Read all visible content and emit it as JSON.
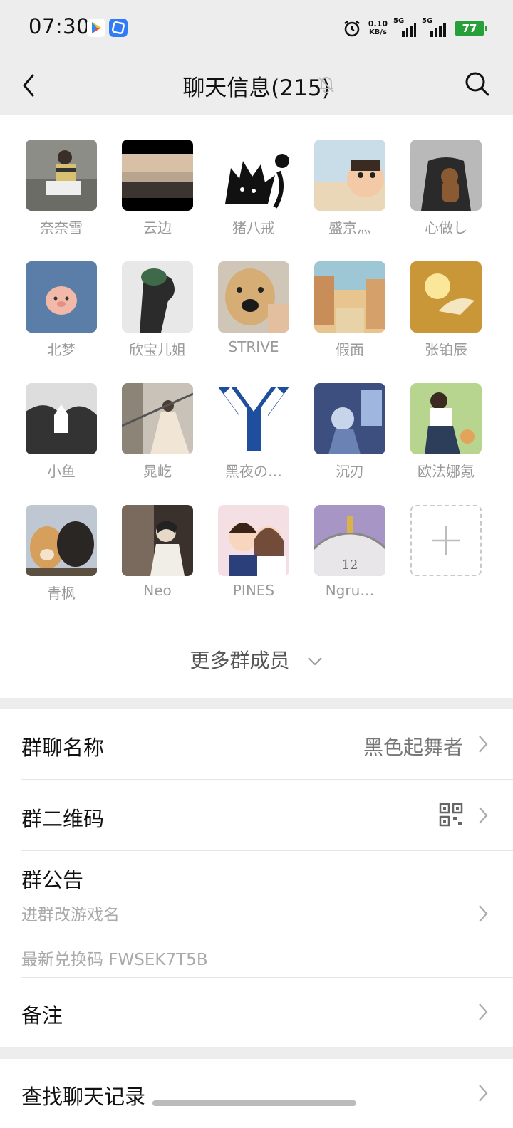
{
  "status_bar": {
    "time": "07:30",
    "net_speed_value": "0.10",
    "net_speed_unit": "KB/s",
    "signal_1_label": "5G",
    "signal_2_label": "5G",
    "battery": "77",
    "icons": [
      "play-store-icon",
      "app-icon",
      "alarm-icon"
    ]
  },
  "header": {
    "title": "聊天信息(215)",
    "back_icon": "chevron-left-icon",
    "mute_icon": "bell-off-icon",
    "search_icon": "search-icon"
  },
  "members": [
    {
      "name": "奈奈雪"
    },
    {
      "name": "云边"
    },
    {
      "name": "猪八戒"
    },
    {
      "name": "盛京灬"
    },
    {
      "name": "心做し"
    },
    {
      "name": "北梦"
    },
    {
      "name": "欣宝儿姐"
    },
    {
      "name": "STRIVE"
    },
    {
      "name": "假面"
    },
    {
      "name": "张铂辰"
    },
    {
      "name": "小鱼"
    },
    {
      "name": "晁屹"
    },
    {
      "name": "黑夜の…"
    },
    {
      "name": "沉刃"
    },
    {
      "name": "欧法娜氪"
    },
    {
      "name": "青枫"
    },
    {
      "name": "Neo"
    },
    {
      "name": "PINES"
    },
    {
      "name": "Ngru…"
    }
  ],
  "more_members_label": "更多群成员",
  "settings": {
    "group_name_label": "群聊名称",
    "group_name_value": "黑色起舞者",
    "qr_label": "群二维码",
    "notice_label": "群公告",
    "notice_line1": "进群改游戏名",
    "notice_line2": "最新兑换码 FWSEK7T5B",
    "remark_label": "备注"
  },
  "bottom": {
    "search_history_label": "查找聊天记录"
  },
  "colors": {
    "background": "#ededed",
    "card": "#ffffff",
    "battery": "#27a03a",
    "secondary_text": "#9a9a9a"
  }
}
